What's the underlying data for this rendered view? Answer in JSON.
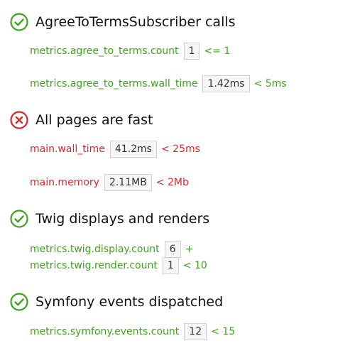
{
  "colors": {
    "pass": "#3fa21e",
    "fail": "#d42a2a"
  },
  "sections": [
    {
      "status": "pass",
      "icon": "check-circle-icon",
      "title": "AgreeToTermsSubscriber calls",
      "assertions": [
        {
          "metric": "metrics.agree_to_terms.count",
          "value": "1",
          "condition": "<= 1"
        },
        {
          "metric": "metrics.agree_to_terms.wall_time",
          "value": "1.42ms",
          "condition": "< 5ms"
        }
      ]
    },
    {
      "status": "fail",
      "icon": "x-circle-icon",
      "title": "All pages are fast",
      "assertions": [
        {
          "metric": "main.wall_time",
          "value": "41.2ms",
          "condition": "< 25ms"
        },
        {
          "metric": "main.memory",
          "value": "2.11MB",
          "condition": "< 2Mb"
        }
      ]
    },
    {
      "status": "pass",
      "icon": "check-circle-icon",
      "title": "Twig displays and renders",
      "assertions": [
        {
          "metric": "metrics.twig.display.count",
          "value": "6",
          "condition": "+"
        },
        {
          "metric": "metrics.twig.render.count",
          "value": "1",
          "condition": "< 10"
        }
      ]
    },
    {
      "status": "pass",
      "icon": "check-circle-icon",
      "title": "Symfony events dispatched",
      "assertions": [
        {
          "metric": "metrics.symfony.events.count",
          "value": "12",
          "condition": "< 15"
        }
      ]
    }
  ]
}
